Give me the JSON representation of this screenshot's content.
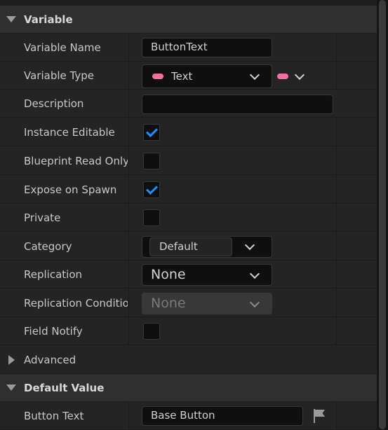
{
  "sections": {
    "variable": "Variable",
    "advanced": "Advanced",
    "default_value": "Default Value"
  },
  "rows": {
    "variable_name": {
      "label": "Variable Name",
      "value": "ButtonText"
    },
    "variable_type": {
      "label": "Variable Type",
      "value": "Text"
    },
    "description": {
      "label": "Description",
      "value": ""
    },
    "instance_editable": {
      "label": "Instance Editable",
      "checked": true
    },
    "blueprint_read_only": {
      "label": "Blueprint Read Only",
      "checked": false
    },
    "expose_on_spawn": {
      "label": "Expose on Spawn",
      "checked": true
    },
    "private": {
      "label": "Private",
      "checked": false
    },
    "category": {
      "label": "Category",
      "value": "Default"
    },
    "replication": {
      "label": "Replication",
      "value": "None"
    },
    "replication_condition": {
      "label": "Replication Condition",
      "value": "None"
    },
    "field_notify": {
      "label": "Field Notify",
      "checked": false
    }
  },
  "default_values": {
    "button_text": {
      "label": "Button Text",
      "value": "Base Button"
    }
  },
  "icons": {
    "type_pill_color": "#f56fa7",
    "check_color": "#1c8fff",
    "localization": "flag-icon"
  }
}
